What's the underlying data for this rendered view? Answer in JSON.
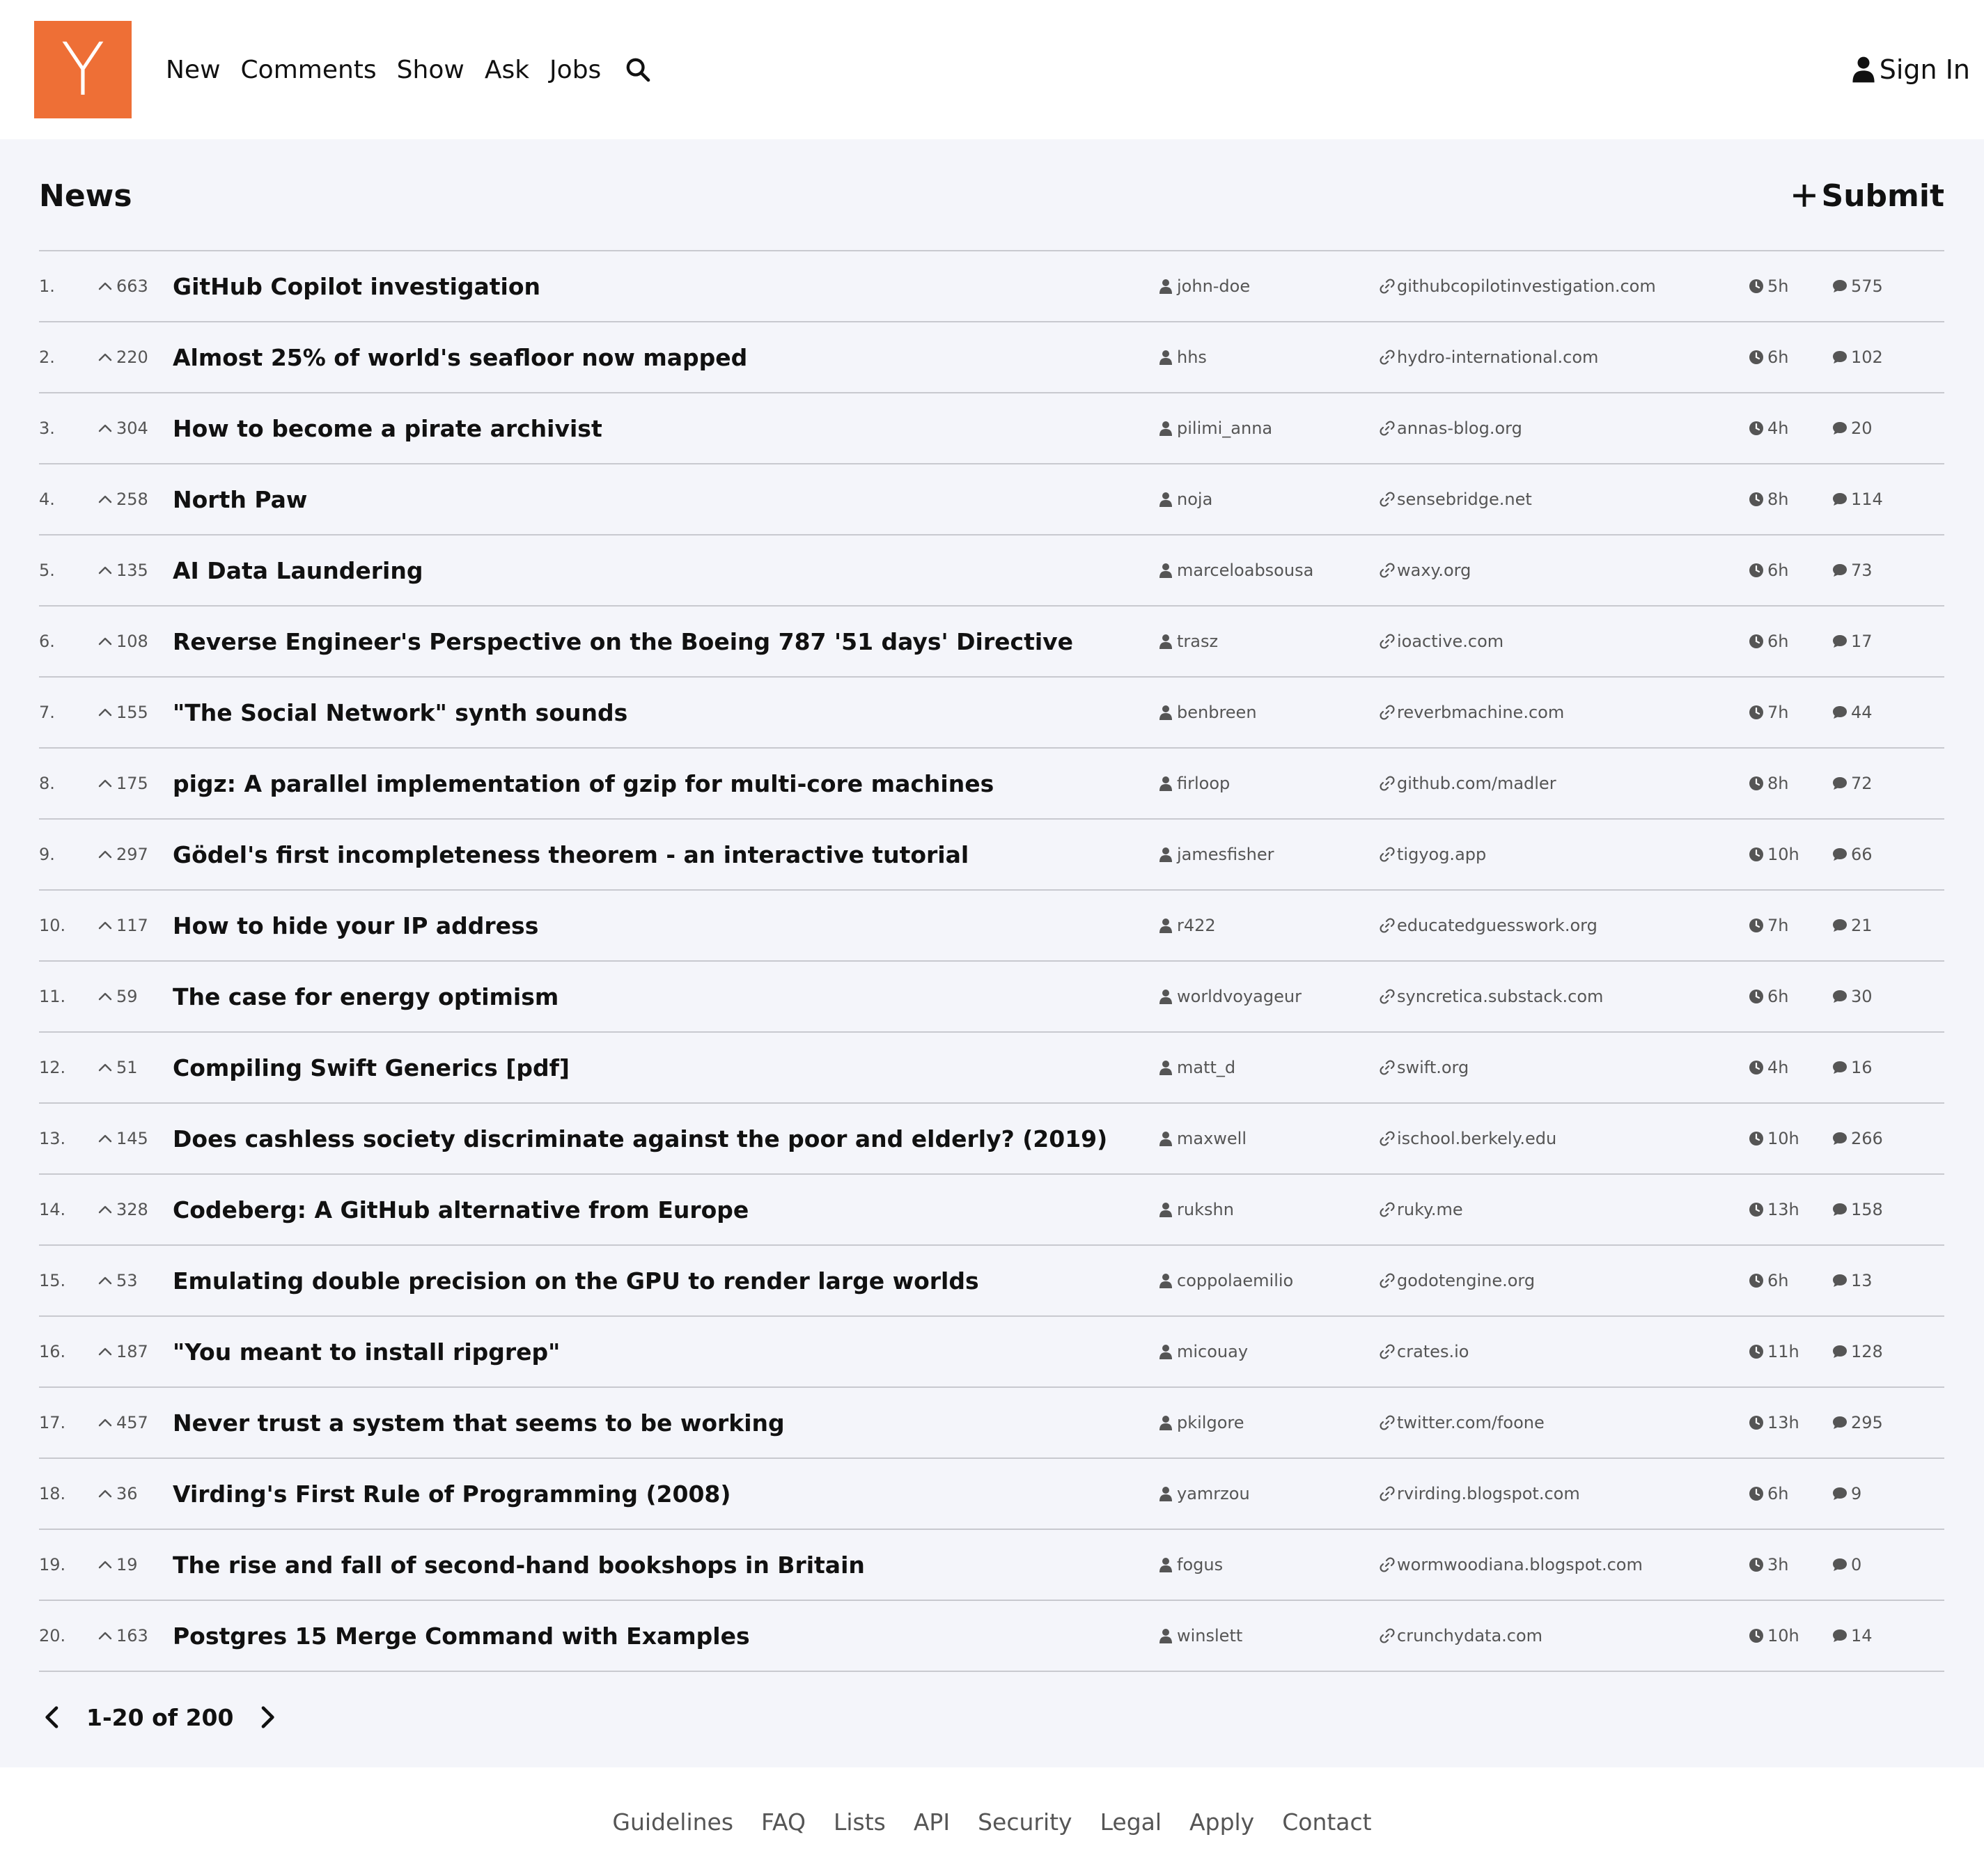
{
  "header": {
    "logo_letter": "Y",
    "nav": [
      "New",
      "Comments",
      "Show",
      "Ask",
      "Jobs"
    ],
    "signin_label": "Sign In"
  },
  "colors": {
    "logo_bg": "#ee6f36",
    "page_bg": "#f4f5fa",
    "text": "#111111",
    "meta": "#555555"
  },
  "main": {
    "title": "News",
    "submit_label": "Submit",
    "stories": [
      {
        "rank": "1.",
        "points": "663",
        "title": "GitHub Copilot investigation",
        "user": "john-doe",
        "domain": "githubcopilotinvestigation.com",
        "age": "5h",
        "comments": "575"
      },
      {
        "rank": "2.",
        "points": "220",
        "title": "Almost 25% of world's seafloor now mapped",
        "user": "hhs",
        "domain": "hydro-international.com",
        "age": "6h",
        "comments": "102"
      },
      {
        "rank": "3.",
        "points": "304",
        "title": "How to become a pirate archivist",
        "user": "pilimi_anna",
        "domain": "annas-blog.org",
        "age": "4h",
        "comments": "20"
      },
      {
        "rank": "4.",
        "points": "258",
        "title": "North Paw",
        "user": "noja",
        "domain": "sensebridge.net",
        "age": "8h",
        "comments": "114"
      },
      {
        "rank": "5.",
        "points": "135",
        "title": "AI Data Laundering",
        "user": "marceloabsousa",
        "domain": "waxy.org",
        "age": "6h",
        "comments": "73"
      },
      {
        "rank": "6.",
        "points": "108",
        "title": "Reverse Engineer's Perspective on the Boeing 787 '51 days' Directive",
        "user": "trasz",
        "domain": "ioactive.com",
        "age": "6h",
        "comments": "17"
      },
      {
        "rank": "7.",
        "points": "155",
        "title": "\"The Social Network\" synth sounds",
        "user": "benbreen",
        "domain": "reverbmachine.com",
        "age": "7h",
        "comments": "44"
      },
      {
        "rank": "8.",
        "points": "175",
        "title": "pigz: A parallel implementation of gzip for multi-core machines",
        "user": "firloop",
        "domain": "github.com/madler",
        "age": "8h",
        "comments": "72"
      },
      {
        "rank": "9.",
        "points": "297",
        "title": "Gödel's first incompleteness theorem - an interactive tutorial",
        "user": "jamesfisher",
        "domain": "tigyog.app",
        "age": "10h",
        "comments": "66"
      },
      {
        "rank": "10.",
        "points": "117",
        "title": "How to hide your IP address",
        "user": "r422",
        "domain": "educatedguesswork.org",
        "age": "7h",
        "comments": "21"
      },
      {
        "rank": "11.",
        "points": "59",
        "title": "The case for energy optimism",
        "user": "worldvoyageur",
        "domain": "syncretica.substack.com",
        "age": "6h",
        "comments": "30"
      },
      {
        "rank": "12.",
        "points": "51",
        "title": "Compiling Swift Generics [pdf]",
        "user": "matt_d",
        "domain": "swift.org",
        "age": "4h",
        "comments": "16"
      },
      {
        "rank": "13.",
        "points": "145",
        "title": "Does cashless society discriminate against the poor and elderly? (2019)",
        "user": "maxwell",
        "domain": "ischool.berkely.edu",
        "age": "10h",
        "comments": "266"
      },
      {
        "rank": "14.",
        "points": "328",
        "title": "Codeberg: A GitHub alternative from Europe",
        "user": "rukshn",
        "domain": "ruky.me",
        "age": "13h",
        "comments": "158"
      },
      {
        "rank": "15.",
        "points": "53",
        "title": "Emulating double precision on the GPU to render large worlds",
        "user": "coppolaemilio",
        "domain": "godotengine.org",
        "age": "6h",
        "comments": "13"
      },
      {
        "rank": "16.",
        "points": "187",
        "title": "\"You meant to install ripgrep\"",
        "user": "micouay",
        "domain": "crates.io",
        "age": "11h",
        "comments": "128"
      },
      {
        "rank": "17.",
        "points": "457",
        "title": "Never trust a system that seems to be working",
        "user": "pkilgore",
        "domain": "twitter.com/foone",
        "age": "13h",
        "comments": "295"
      },
      {
        "rank": "18.",
        "points": "36",
        "title": "Virding's First Rule of Programming (2008)",
        "user": "yamrzou",
        "domain": "rvirding.blogspot.com",
        "age": "6h",
        "comments": "9"
      },
      {
        "rank": "19.",
        "points": "19",
        "title": "The rise and fall of second-hand bookshops in Britain",
        "user": "fogus",
        "domain": "wormwoodiana.blogspot.com",
        "age": "3h",
        "comments": "0"
      },
      {
        "rank": "20.",
        "points": "163",
        "title": "Postgres 15 Merge Command with Examples",
        "user": "winslett",
        "domain": "crunchydata.com",
        "age": "10h",
        "comments": "14"
      }
    ],
    "pagination": "1-20 of 200"
  },
  "footer": {
    "links": [
      "Guidelines",
      "FAQ",
      "Lists",
      "API",
      "Security",
      "Legal",
      "Apply",
      "Contact"
    ]
  },
  "icons": {
    "search": "search-icon",
    "user": "user-icon",
    "plus": "plus-icon",
    "upvote": "chevron-up-icon",
    "link": "link-icon",
    "clock": "clock-icon",
    "comment": "comment-icon",
    "prev": "chevron-left-icon",
    "next": "chevron-right-icon"
  }
}
